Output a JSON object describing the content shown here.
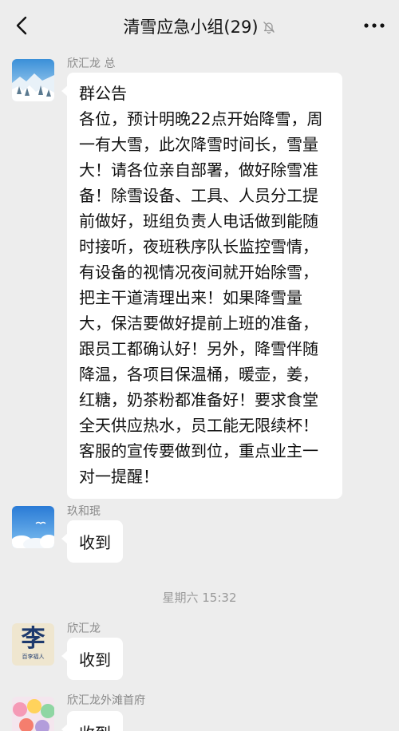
{
  "header": {
    "title": "清雪应急小组(29)",
    "back_icon": "chevron-left-icon",
    "mute_icon": "bell-muted-icon",
    "more_icon": "more-dots-icon"
  },
  "messages": [
    {
      "sender": "欣汇龙 总",
      "announcement_title": "群公告",
      "text": "各位，预计明晚22点开始降雪，周一有大雪，此次降雪时间长，雪量大！请各位亲自部署，做好除雪准备！除雪设备、工具、人员分工提前做好，班组负责人电话做到能随时接听，夜班秩序队长监控雪情，有设备的视情况夜间就开始除雪，把主干道清理出来！如果降雪量大，保洁要做好提前上班的准备，跟员工都确认好！另外，降雪伴随降温，各项目保温桶，暖壶，姜，红糖，奶茶粉都准备好！要求食堂全天供应热水，员工能无限续杯！客服的宣传要做到位，重点业主一对一提醒！"
    },
    {
      "sender": "玖和珉",
      "text": "收到"
    },
    {
      "sender": "欣汇龙",
      "text": "收到"
    },
    {
      "sender": "欣汇龙外滩首府",
      "text": "收到"
    }
  ],
  "timestamp": "星期六 15:32",
  "avatar_text": "李",
  "avatar_subtext": "百李福人"
}
